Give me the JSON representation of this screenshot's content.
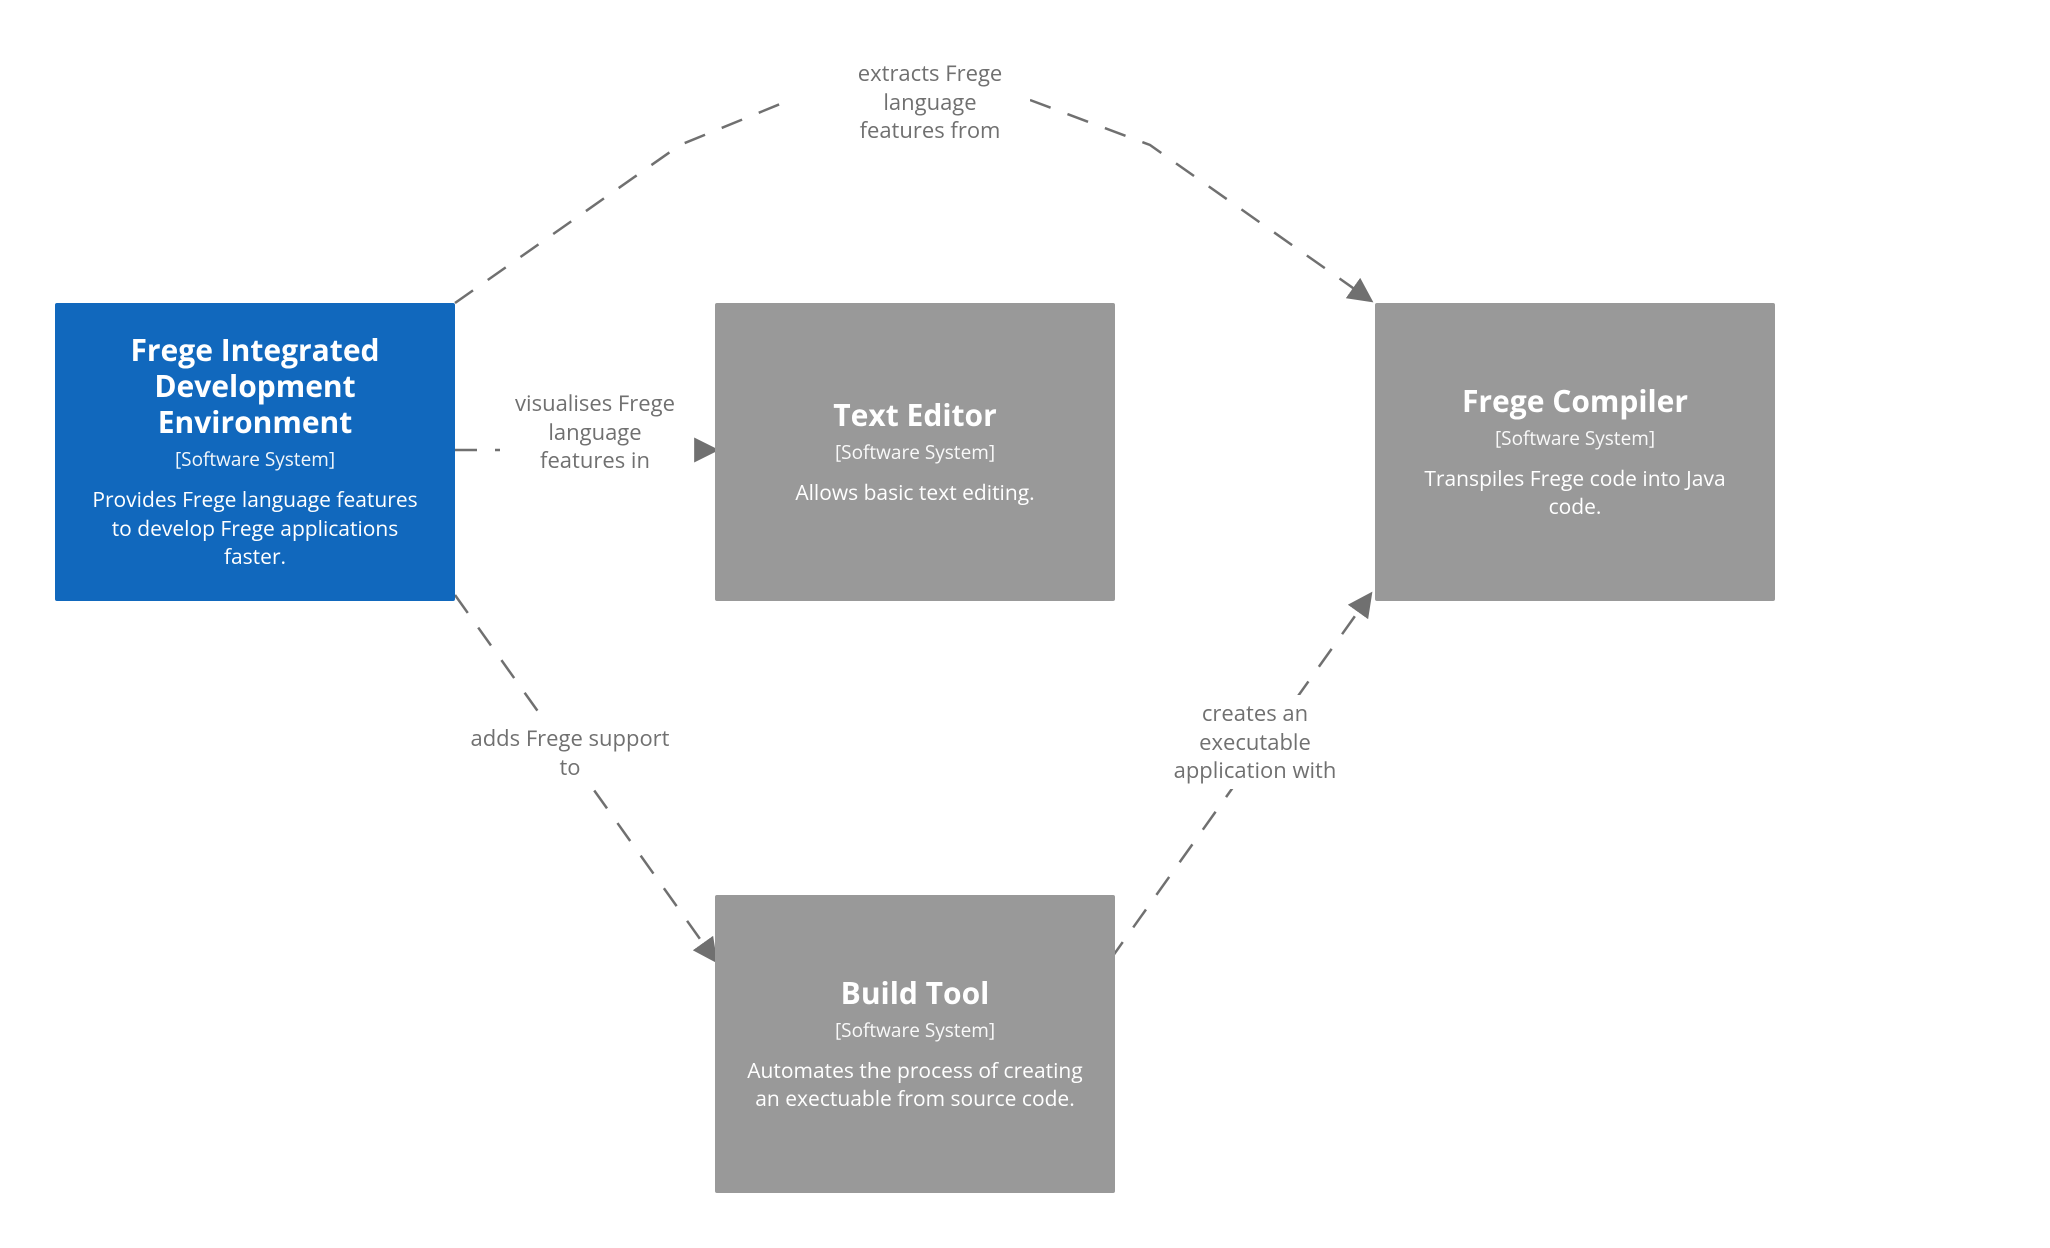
{
  "nodes": {
    "ide": {
      "title": "Frege Integrated Development Environment",
      "subtitle": "[Software System]",
      "desc": "Provides Frege language features to develop Frege applications faster."
    },
    "editor": {
      "title": "Text Editor",
      "subtitle": "[Software System]",
      "desc": "Allows basic text editing."
    },
    "compiler": {
      "title": "Frege Compiler",
      "subtitle": "[Software System]",
      "desc": "Transpiles Frege code into Java code."
    },
    "build": {
      "title": "Build Tool",
      "subtitle": "[Software System]",
      "desc": "Automates the process of creating an exectuable from source code."
    }
  },
  "edges": {
    "ide_compiler": "extracts Frege language features from",
    "ide_editor": "visualises Frege language features in",
    "ide_build": "adds Frege support to",
    "build_compiler": "creates an executable application with"
  }
}
